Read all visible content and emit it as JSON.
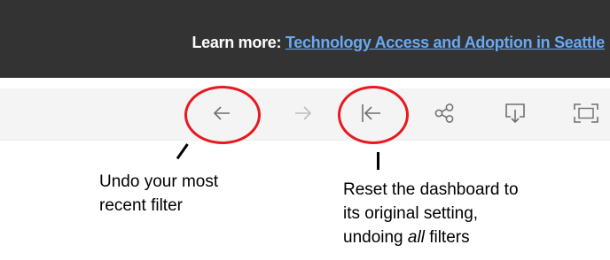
{
  "banner": {
    "prefix": "Learn more: ",
    "link_text": "Technology Access and Adoption in Seattle",
    "background": "#333333",
    "link_color": "#6aa9f2"
  },
  "toolbar": {
    "buttons": [
      {
        "name": "undo",
        "icon": "arrow-left-icon"
      },
      {
        "name": "redo",
        "icon": "arrow-right-icon"
      },
      {
        "name": "revert",
        "icon": "revert-icon"
      },
      {
        "name": "share",
        "icon": "share-icon"
      },
      {
        "name": "download",
        "icon": "download-icon"
      },
      {
        "name": "fullscreen",
        "icon": "fullscreen-icon"
      }
    ]
  },
  "annotations": {
    "highlight_color": "#e8191f",
    "undo_line1": "Undo your most",
    "undo_line2": "recent filter",
    "reset_line1": "Reset the dashboard to",
    "reset_line2": "its original setting,",
    "reset_line3_pre": "undoing ",
    "reset_line3_em": "all",
    "reset_line3_post": " filters"
  }
}
